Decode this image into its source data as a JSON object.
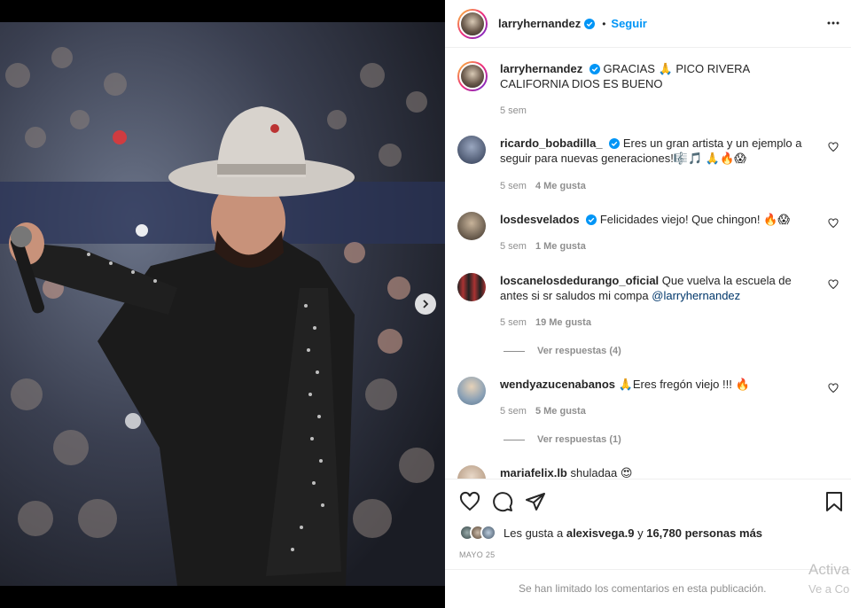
{
  "post": {
    "author": "larryhernandez",
    "follow_label": "Seguir",
    "separator": "•",
    "caption": "GRACIAS 🙏 PICO RIVERA CALIFORNIA DIOS ES BUENO",
    "caption_time": "5 sem"
  },
  "comments": [
    {
      "user": "ricardo_bobadilla_",
      "verified": true,
      "text": "Eres un gran artista y un ejemplo a seguir para nuevas generaciones!🎼🎵 🙏🔥😱",
      "time": "5 sem",
      "likes": "4 Me gusta"
    },
    {
      "user": "losdesvelados",
      "verified": true,
      "text": "Felicidades viejo! Que chingon! 🔥😱",
      "time": "5 sem",
      "likes": "1 Me gusta"
    },
    {
      "user": "loscanelosdedurango_oficial",
      "verified": false,
      "text": "Que vuelva la escuela de antes si sr saludos mi compa",
      "mention": "@larryhernandez",
      "time": "5 sem",
      "likes": "19 Me gusta",
      "replies": "Ver respuestas (4)"
    },
    {
      "user": "wendyazucenabanos",
      "verified": false,
      "text": "🙏Eres fregón viejo !!! 🔥",
      "time": "5 sem",
      "likes": "5 Me gusta",
      "replies": "Ver respuestas (1)"
    },
    {
      "user": "mariafelix.lb",
      "verified": false,
      "text": "shuladaa 😍"
    }
  ],
  "likes": {
    "prefix": "Les gusta a",
    "user": "alexisvega.9",
    "middle": "y",
    "count": "16,780 personas más"
  },
  "date": "MAYO 25",
  "comments_limited": "Se han limitado los comentarios en esta publicación.",
  "watermark": {
    "line1": "Activa",
    "line2": "Ve a Co"
  },
  "colors": {
    "accent": "#0095f6",
    "text": "#262626",
    "muted": "#8e8e8e",
    "verified": "#0095f6"
  },
  "icons": [
    "more-icon",
    "heart-icon",
    "comment-icon",
    "share-icon",
    "bookmark-icon",
    "verified-icon",
    "chevron-right-icon"
  ]
}
